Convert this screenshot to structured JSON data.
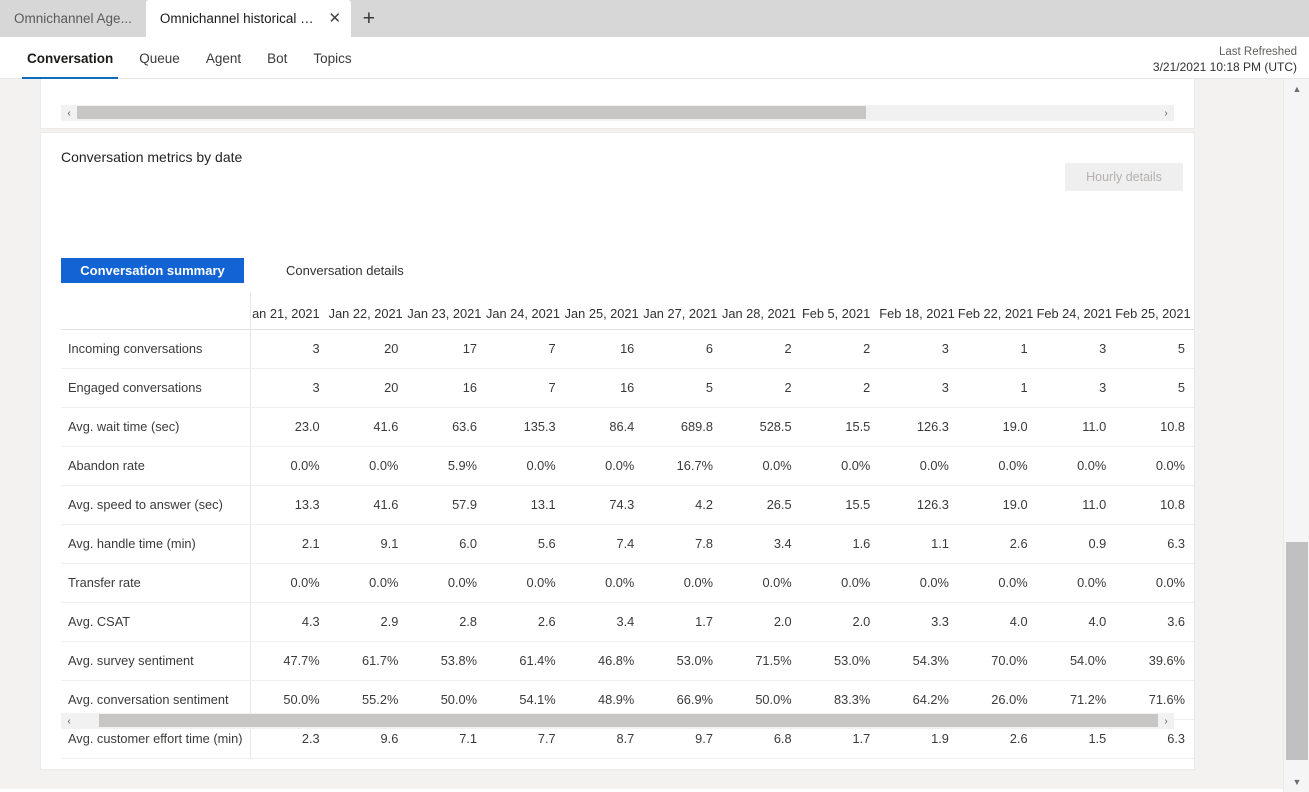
{
  "browser": {
    "tabs": [
      {
        "title": "Omnichannel Age...",
        "active": false
      },
      {
        "title": "Omnichannel historical an...",
        "active": true
      }
    ],
    "close_glyph": "✕",
    "new_tab_glyph": "+"
  },
  "header": {
    "nav_tabs": [
      {
        "label": "Conversation",
        "selected": true
      },
      {
        "label": "Queue",
        "selected": false
      },
      {
        "label": "Agent",
        "selected": false
      },
      {
        "label": "Bot",
        "selected": false
      },
      {
        "label": "Topics",
        "selected": false
      }
    ],
    "refresh_label": "Last Refreshed",
    "refresh_value": "3/21/2021 10:18 PM (UTC)"
  },
  "scrollbars": {
    "left_arrow": "‹",
    "right_arrow": "›",
    "up_arrow": "▲",
    "down_arrow": "▼"
  },
  "card": {
    "title": "Conversation metrics by date",
    "hourly_details_label": "Hourly details",
    "segments": [
      {
        "label": "Conversation summary",
        "selected": true
      },
      {
        "label": "Conversation details",
        "selected": false
      }
    ]
  },
  "chart_data": {
    "type": "table",
    "title": "Conversation metrics by date",
    "row_header_label": "",
    "categories": [
      "an 21, 2021",
      "Jan 22, 2021",
      "Jan 23, 2021",
      "Jan 24, 2021",
      "Jan 25, 2021",
      "Jan 27, 2021",
      "Jan 28, 2021",
      "Feb 5, 2021",
      "Feb 18, 2021",
      "Feb 22, 2021",
      "Feb 24, 2021",
      "Feb 25, 2021"
    ],
    "series": [
      {
        "name": "Incoming conversations",
        "values": [
          "3",
          "20",
          "17",
          "7",
          "16",
          "6",
          "2",
          "2",
          "3",
          "1",
          "3",
          "5"
        ]
      },
      {
        "name": "Engaged conversations",
        "values": [
          "3",
          "20",
          "16",
          "7",
          "16",
          "5",
          "2",
          "2",
          "3",
          "1",
          "3",
          "5"
        ]
      },
      {
        "name": "Avg. wait time (sec)",
        "values": [
          "23.0",
          "41.6",
          "63.6",
          "135.3",
          "86.4",
          "689.8",
          "528.5",
          "15.5",
          "126.3",
          "19.0",
          "11.0",
          "10.8"
        ]
      },
      {
        "name": "Abandon rate",
        "values": [
          "0.0%",
          "0.0%",
          "5.9%",
          "0.0%",
          "0.0%",
          "16.7%",
          "0.0%",
          "0.0%",
          "0.0%",
          "0.0%",
          "0.0%",
          "0.0%"
        ]
      },
      {
        "name": "Avg. speed to answer (sec)",
        "values": [
          "13.3",
          "41.6",
          "57.9",
          "13.1",
          "74.3",
          "4.2",
          "26.5",
          "15.5",
          "126.3",
          "19.0",
          "11.0",
          "10.8"
        ]
      },
      {
        "name": "Avg. handle time (min)",
        "values": [
          "2.1",
          "9.1",
          "6.0",
          "5.6",
          "7.4",
          "7.8",
          "3.4",
          "1.6",
          "1.1",
          "2.6",
          "0.9",
          "6.3"
        ]
      },
      {
        "name": "Transfer rate",
        "values": [
          "0.0%",
          "0.0%",
          "0.0%",
          "0.0%",
          "0.0%",
          "0.0%",
          "0.0%",
          "0.0%",
          "0.0%",
          "0.0%",
          "0.0%",
          "0.0%"
        ]
      },
      {
        "name": "Avg. CSAT",
        "values": [
          "4.3",
          "2.9",
          "2.8",
          "2.6",
          "3.4",
          "1.7",
          "2.0",
          "2.0",
          "3.3",
          "4.0",
          "4.0",
          "3.6"
        ]
      },
      {
        "name": "Avg. survey sentiment",
        "values": [
          "47.7%",
          "61.7%",
          "53.8%",
          "61.4%",
          "46.8%",
          "53.0%",
          "71.5%",
          "53.0%",
          "54.3%",
          "70.0%",
          "54.0%",
          "39.6%"
        ]
      },
      {
        "name": "Avg. conversation sentiment",
        "values": [
          "50.0%",
          "55.2%",
          "50.0%",
          "54.1%",
          "48.9%",
          "66.9%",
          "50.0%",
          "83.3%",
          "64.2%",
          "26.0%",
          "71.2%",
          "71.6%"
        ]
      },
      {
        "name": "Avg. customer effort time (min)",
        "values": [
          "2.3",
          "9.6",
          "7.1",
          "7.7",
          "8.7",
          "9.7",
          "6.8",
          "1.7",
          "1.9",
          "2.6",
          "1.5",
          "6.3"
        ]
      }
    ]
  },
  "colors": {
    "accent": "#1264d4",
    "nav_underline": "#0f6cbd",
    "scroll_thumb": "#c8c6c4",
    "canvas_bg": "#f3f2f1"
  }
}
